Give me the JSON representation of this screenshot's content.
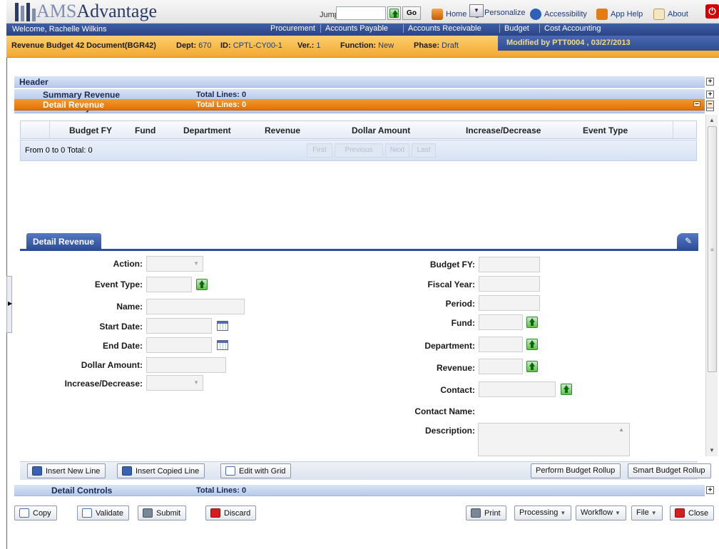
{
  "header": {
    "logo_text_ams": "AMS",
    "logo_text_rest": "Advantage",
    "jump_to_label": "Jump to:",
    "go_label": "Go",
    "links": [
      {
        "label": "Home",
        "icon": "home-icon"
      },
      {
        "label": "Personalize",
        "icon": "wrench-icon"
      },
      {
        "label": "Accessibility",
        "icon": "accessibility-icon"
      },
      {
        "label": "App Help",
        "icon": "help-icon"
      },
      {
        "label": "About",
        "icon": "about-icon"
      }
    ],
    "power_icon": "power-icon"
  },
  "nav": {
    "welcome": "Welcome, Rachelle Wilkins",
    "items": [
      "Procurement",
      "Accounts Payable",
      "Accounts Receivable",
      "Budget",
      "Cost Accounting"
    ]
  },
  "doc": {
    "title": "Revenue Budget 42 Document(BGR42)",
    "dept_label": "Dept:",
    "dept": "670",
    "id_label": "ID:",
    "id": "CPTL-CY00-1",
    "ver_label": "Ver.:",
    "ver": "1",
    "function_label": "Function:",
    "function": "New",
    "phase_label": "Phase:",
    "phase": "Draft",
    "modified": "Modified by PTT0004 , 03/27/2013"
  },
  "sections": {
    "header": {
      "label": "Header"
    },
    "summary_revenue": {
      "label": "Summary Revenue",
      "total": "Total Lines: 0"
    },
    "summary_controls": {
      "label": "Summary Controls",
      "total": "Total Lines: 0"
    },
    "detail_revenue": {
      "label": "Detail Revenue",
      "total": "Total Lines: 0"
    },
    "detail_controls": {
      "label": "Detail Controls",
      "total": "Total Lines: 0"
    }
  },
  "grid": {
    "columns": [
      "Budget FY",
      "Fund",
      "Department",
      "Revenue",
      "Dollar Amount",
      "Increase/Decrease",
      "Event Type"
    ],
    "pager_text": "From 0 to 0 Total: 0",
    "pager_buttons": [
      "First",
      "Previous",
      "Next",
      "Last"
    ]
  },
  "form": {
    "tab_label": "Detail Revenue",
    "left_fields": [
      {
        "label": "Action:"
      },
      {
        "label": "Event Type:"
      },
      {
        "label": "Name:"
      },
      {
        "label": "Start Date:"
      },
      {
        "label": "End Date:"
      },
      {
        "label": "Dollar Amount:"
      },
      {
        "label": "Increase/Decrease:"
      }
    ],
    "right_fields": [
      {
        "label": "Budget FY:"
      },
      {
        "label": "Fiscal Year:"
      },
      {
        "label": "Period:"
      },
      {
        "label": "Fund:"
      },
      {
        "label": "Department:"
      },
      {
        "label": "Revenue:"
      },
      {
        "label": "Contact:"
      },
      {
        "label": "Contact Name:"
      },
      {
        "label": "Description:"
      }
    ]
  },
  "actions": {
    "insert_new_line": "Insert New Line",
    "insert_copied_line": "Insert Copied Line",
    "edit_with_grid": "Edit with Grid",
    "perform_budget_rollup": "Perform Budget Rollup",
    "smart_budget_rollup": "Smart Budget Rollup"
  },
  "bottom": {
    "copy": "Copy",
    "validate": "Validate",
    "submit": "Submit",
    "discard": "Discard",
    "print": "Print",
    "processing": "Processing",
    "workflow": "Workflow",
    "file": "File",
    "close": "Close"
  },
  "colors": {
    "nav_blue": "#2b4585",
    "doc_orange": "#f2a830",
    "detail_section_orange": "#e27008",
    "modified_text": "#f5dc7b"
  }
}
